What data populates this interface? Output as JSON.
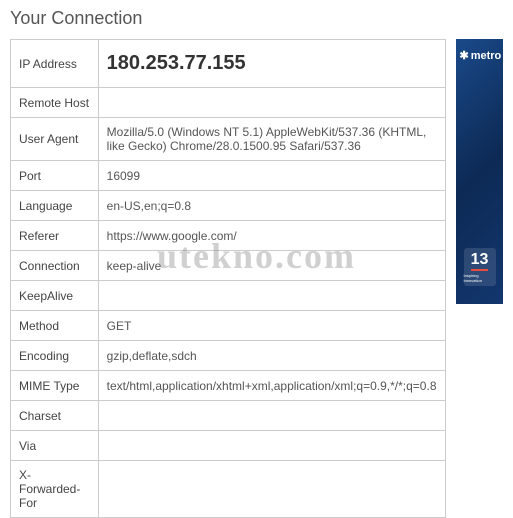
{
  "title": "Your Connection",
  "rows": [
    {
      "label": "IP Address",
      "value": "180.253.77.155",
      "ip": true
    },
    {
      "label": "Remote Host",
      "value": ""
    },
    {
      "label": "User Agent",
      "value": "Mozilla/5.0 (Windows NT 5.1) AppleWebKit/537.36 (KHTML, like Gecko) Chrome/28.0.1500.95 Safari/537.36"
    },
    {
      "label": "Port",
      "value": "16099"
    },
    {
      "label": "Language",
      "value": "en-US,en;q=0.8"
    },
    {
      "label": "Referer",
      "value": "https://www.google.com/"
    },
    {
      "label": "Connection",
      "value": "keep-alive"
    },
    {
      "label": "KeepAlive",
      "value": ""
    },
    {
      "label": "Method",
      "value": "GET"
    },
    {
      "label": "Encoding",
      "value": "gzip,deflate,sdch"
    },
    {
      "label": "MIME Type",
      "value": "text/html,application/xhtml+xml,application/xml;q=0.9,*/*;q=0.8"
    },
    {
      "label": "Charset",
      "value": ""
    },
    {
      "label": "Via",
      "value": ""
    },
    {
      "label": "X-Forwarded-For",
      "value": ""
    }
  ],
  "ad": {
    "logo": "metro",
    "badge": "13",
    "badge_sub": "Inspiring Innovation"
  },
  "watermark": "utekno.com"
}
